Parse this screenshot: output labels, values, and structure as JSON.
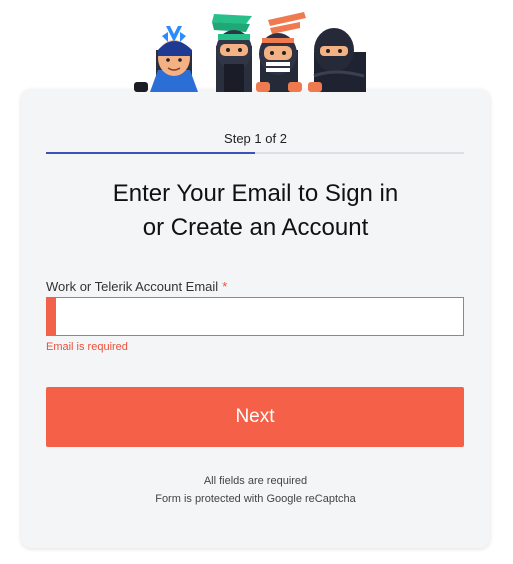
{
  "colors": {
    "accent": "#f46148",
    "error": "#e9513b",
    "progress": "#3f51b5",
    "card_background": "#f4f5f7"
  },
  "illustration": {
    "icon": "ninja-mascots-illustration"
  },
  "form": {
    "step_label": "Step 1 of 2",
    "progress_fraction": 0.5,
    "title_line1": "Enter Your Email to Sign in",
    "title_line2": "or Create an Account",
    "email_label": "Work or Telerik Account Email",
    "required_marker": "*",
    "email_value": "",
    "email_error": "Email is required",
    "next_label": "Next",
    "footnote_required": "All fields are required",
    "footnote_captcha": "Form is protected with Google reCaptcha"
  }
}
